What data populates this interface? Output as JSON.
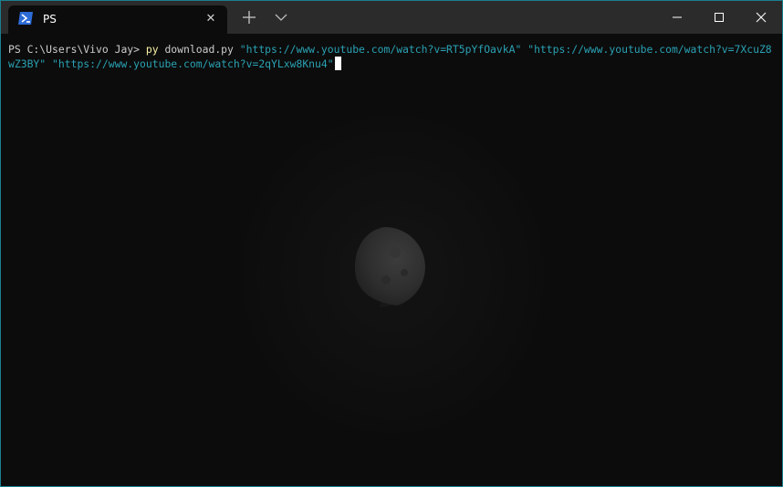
{
  "tab": {
    "title": "PS",
    "close_glyph": "✕",
    "icon": "powershell-icon"
  },
  "titlebar": {
    "new_tab_icon": "plus-icon",
    "dropdown_icon": "chevron-down-icon",
    "minimize_icon": "minimize-icon",
    "maximize_icon": "maximize-icon",
    "close_icon": "close-icon"
  },
  "terminal": {
    "prompt": "PS C:\\Users\\Vivo Jay> ",
    "command": "py",
    "argument": " download.py ",
    "url1": "\"https://www.youtube.com/watch?v=RT5pYfOavkA\"",
    "url2": " \"https://www.youtube.com/watch?v=7XcuZ8wZ3BY\"",
    "url3": " \"https://www.youtube.com/watch?v=2qYLxw8Knu4\""
  },
  "background": {
    "image": "moon-background"
  },
  "colors": {
    "border": "#1b7f8f",
    "titlebar": "#2b2b2b",
    "terminal_bg": "#0c0c0c",
    "command": "#f9f1a5",
    "string": "#2aa1b3"
  }
}
